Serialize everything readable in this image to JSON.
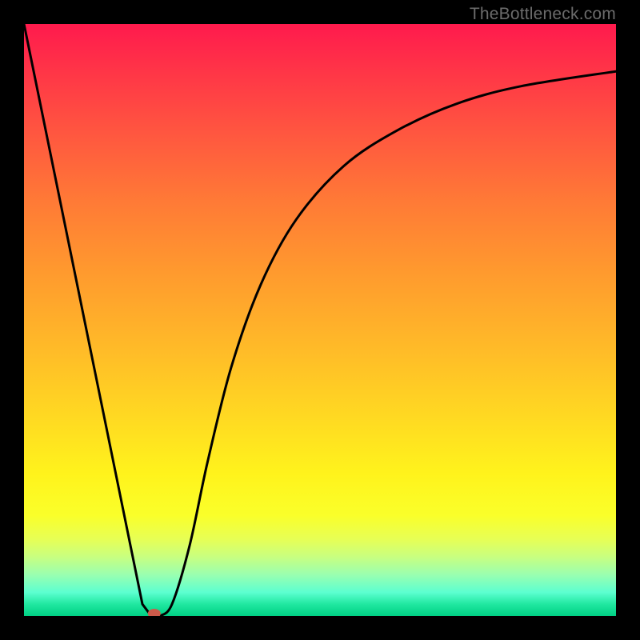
{
  "watermark": "TheBottleneck.com",
  "chart_data": {
    "type": "line",
    "title": "",
    "xlabel": "",
    "ylabel": "",
    "xlim": [
      0,
      100
    ],
    "ylim": [
      0,
      100
    ],
    "grid": false,
    "series": [
      {
        "name": "curve",
        "x": [
          0,
          20,
          21.5,
          23,
          25,
          28,
          31,
          35,
          40,
          46,
          54,
          63,
          73,
          84,
          100
        ],
        "values": [
          100,
          2,
          0,
          0,
          2,
          12,
          26,
          42,
          56,
          67,
          76,
          82,
          86.5,
          89.5,
          92
        ]
      }
    ],
    "marker": {
      "x": 22,
      "y": 0,
      "color": "#cc5a4a"
    },
    "background_gradient": {
      "top": "#ff1a4d",
      "mid": "#ffd822",
      "bottom": "#00d084"
    }
  }
}
